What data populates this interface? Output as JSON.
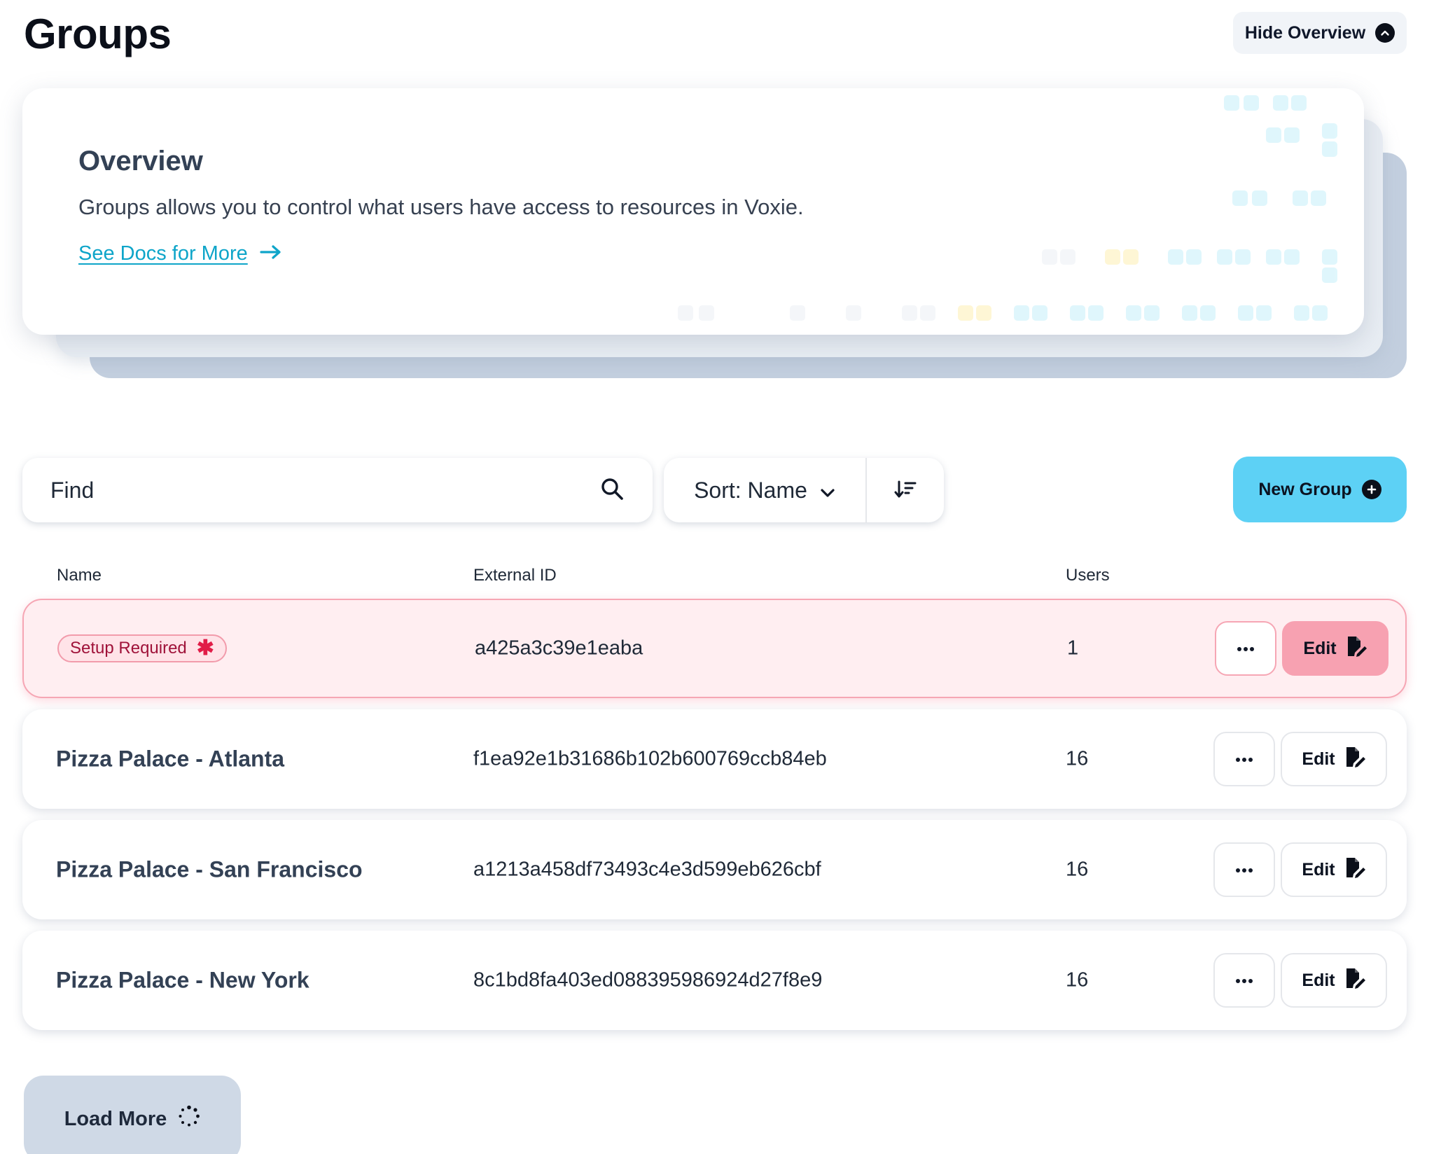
{
  "page": {
    "title": "Groups"
  },
  "header": {
    "hide_overview_label": "Hide Overview"
  },
  "overview": {
    "heading": "Overview",
    "description": "Groups allows you to control what users have access to resources in Voxie.",
    "link_label": "See Docs for More"
  },
  "toolbar": {
    "search_placeholder": "Find",
    "sort_label": "Sort: Name",
    "new_group_label": "New Group"
  },
  "table": {
    "columns": [
      "Name",
      "External ID",
      "Users"
    ],
    "rows": [
      {
        "badge": "Setup Required",
        "external_id": "a425a3c39e1eaba",
        "users": "1",
        "edit_label": "Edit",
        "highlight": true
      },
      {
        "name": "Pizza Palace - Atlanta",
        "external_id": "f1ea92e1b31686b102b600769ccb84eb",
        "users": "16",
        "edit_label": "Edit"
      },
      {
        "name": "Pizza Palace - San Francisco",
        "external_id": "a1213a458df73493c4e3d599eb626cbf",
        "users": "16",
        "edit_label": "Edit"
      },
      {
        "name": "Pizza Palace - New York",
        "external_id": "8c1bd8fa403ed088395986924d27f8e9",
        "users": "16",
        "edit_label": "Edit"
      }
    ]
  },
  "footer": {
    "load_more_label": "Load More"
  },
  "colors": {
    "accent": "#5dd1f5",
    "link": "#0ea5c9",
    "warning_bg": "#ffeef1",
    "warning_border": "#f6a6b4",
    "edit_warning": "#f7a1b1",
    "load_more_bg": "#cfd9e6"
  },
  "icons": [
    "chevron-up-circle-icon",
    "arrow-right-icon",
    "search-icon",
    "chevron-down-icon",
    "sort-descending-icon",
    "plus-circle-icon",
    "asterisk-icon",
    "more-icon",
    "edit-document-icon",
    "spinner-icon"
  ]
}
